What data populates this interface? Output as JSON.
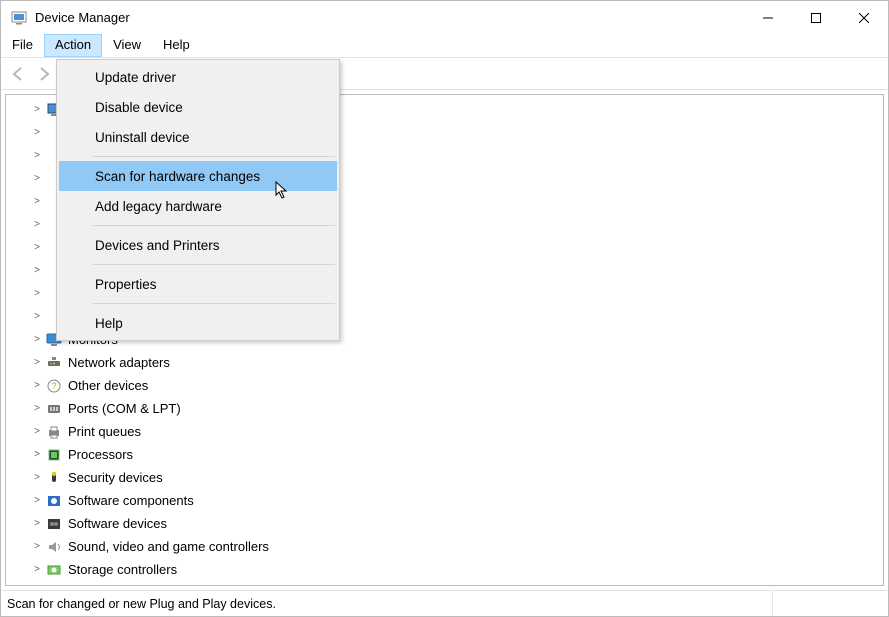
{
  "window": {
    "title": "Device Manager"
  },
  "menubar": [
    "File",
    "Action",
    "View",
    "Help"
  ],
  "menubar_open_index": 1,
  "action_menu": {
    "groups": [
      [
        "Update driver",
        "Disable device",
        "Uninstall device"
      ],
      [
        "Scan for hardware changes",
        "Add legacy hardware"
      ],
      [
        "Devices and Printers"
      ],
      [
        "Properties"
      ],
      [
        "Help"
      ]
    ],
    "highlight": "Scan for hardware changes"
  },
  "tree": [
    {
      "label": "",
      "icon": "computer-icon",
      "depth": 1
    },
    {
      "label": "",
      "icon": "",
      "depth": 1
    },
    {
      "label": "",
      "icon": "",
      "depth": 1
    },
    {
      "label": "",
      "icon": "",
      "depth": 1
    },
    {
      "label": "",
      "icon": "",
      "depth": 1
    },
    {
      "label": "",
      "icon": "",
      "depth": 1
    },
    {
      "label": "",
      "icon": "",
      "depth": 1
    },
    {
      "label": "",
      "icon": "",
      "depth": 1
    },
    {
      "label": "",
      "icon": "",
      "depth": 1
    },
    {
      "label": "",
      "icon": "",
      "depth": 1
    },
    {
      "label": "Monitors",
      "icon": "monitor-icon",
      "depth": 1
    },
    {
      "label": "Network adapters",
      "icon": "network-icon",
      "depth": 1
    },
    {
      "label": "Other devices",
      "icon": "other-icon",
      "depth": 1
    },
    {
      "label": "Ports (COM & LPT)",
      "icon": "port-icon",
      "depth": 1
    },
    {
      "label": "Print queues",
      "icon": "printer-icon",
      "depth": 1
    },
    {
      "label": "Processors",
      "icon": "cpu-icon",
      "depth": 1
    },
    {
      "label": "Security devices",
      "icon": "security-icon",
      "depth": 1
    },
    {
      "label": "Software components",
      "icon": "softcomp-icon",
      "depth": 1
    },
    {
      "label": "Software devices",
      "icon": "softdev-icon",
      "depth": 1
    },
    {
      "label": "Sound, video and game controllers",
      "icon": "sound-icon",
      "depth": 1
    },
    {
      "label": "Storage controllers",
      "icon": "storage-icon",
      "depth": 1
    }
  ],
  "statusbar": "Scan for changed or new Plug and Play devices."
}
